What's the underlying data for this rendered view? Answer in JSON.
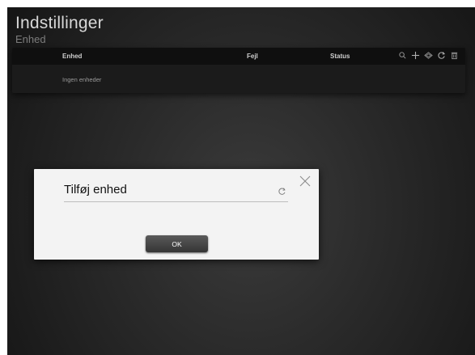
{
  "page": {
    "title": "Indstillinger",
    "subtitle": "Enhed"
  },
  "table": {
    "columns": [
      "Enhed",
      "Fejl",
      "Status"
    ],
    "empty_text": "Ingen enheder",
    "toolbar_icons": [
      "search-icon",
      "add-icon",
      "network-icon",
      "refresh-icon",
      "trash-icon"
    ]
  },
  "dialog": {
    "title": "Tilføj enhed",
    "ok_label": "OK",
    "icons": [
      "close-icon",
      "refresh-icon"
    ]
  },
  "colors": {
    "background": "#2a2a2a",
    "dialog": "#f3f3f3",
    "button": "#454545"
  }
}
